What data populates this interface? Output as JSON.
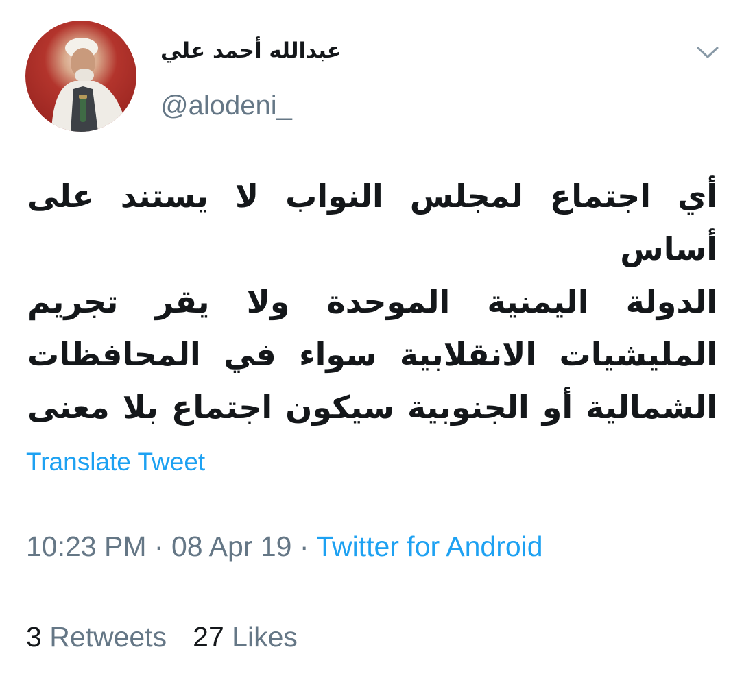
{
  "author": {
    "display_name": "عبدالله أحمد علي",
    "handle": "@alodeni_"
  },
  "tweet": {
    "lines": [
      "أي اجتماع لمجلس النواب لا يستند على أساس",
      "الدولة اليمنية الموحدة ولا يقر تجريم",
      "المليشيات الانقلابية سواء في المحافظات",
      "الشمالية أو الجنوبية سيكون اجتماع بلا معنى"
    ],
    "translate_label": "Translate Tweet"
  },
  "meta": {
    "time": "10:23 PM",
    "separator": " · ",
    "date": "08 Apr 19",
    "source": "Twitter for Android"
  },
  "stats": {
    "retweets_count": "3",
    "retweets_label": "Retweets",
    "likes_count": "27",
    "likes_label": "Likes"
  },
  "icons": {
    "menu": "chevron-down-icon"
  },
  "colors": {
    "link": "#1da1f2",
    "secondary_text": "#657786",
    "primary_text": "#14171a",
    "divider": "#e1e8ed"
  }
}
